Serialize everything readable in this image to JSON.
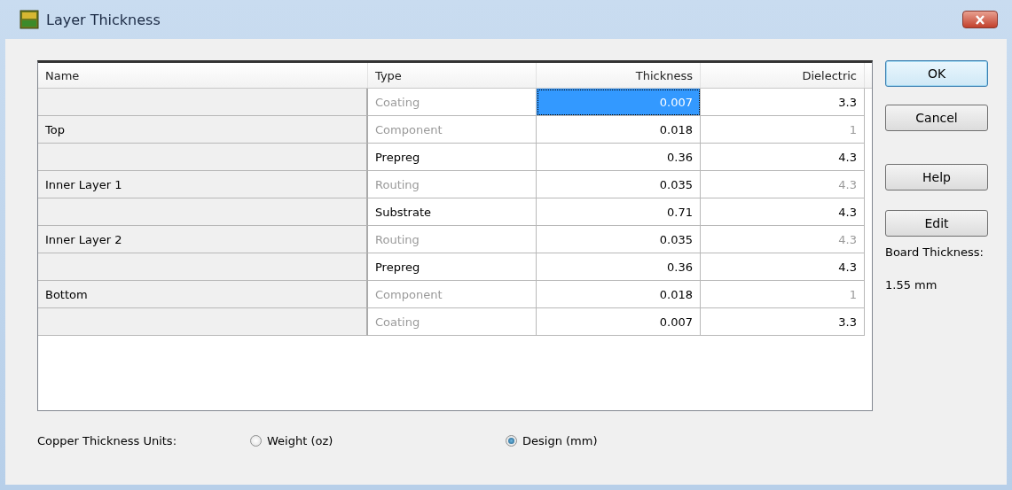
{
  "window": {
    "title": "Layer Thickness"
  },
  "table": {
    "columns": [
      "Name",
      "Type",
      "Thickness",
      "Dielectric"
    ],
    "rows": [
      {
        "name": "",
        "type": "Coating",
        "type_disabled": true,
        "thickness": "0.007",
        "selected": true,
        "dielectric": "3.3",
        "dielectric_disabled": false
      },
      {
        "name": "Top",
        "type": "Component",
        "type_disabled": true,
        "thickness": "0.018",
        "selected": false,
        "dielectric": "1",
        "dielectric_disabled": true
      },
      {
        "name": "",
        "type": "Prepreg",
        "type_disabled": false,
        "thickness": "0.36",
        "selected": false,
        "dielectric": "4.3",
        "dielectric_disabled": false
      },
      {
        "name": "Inner Layer 1",
        "type": "Routing",
        "type_disabled": true,
        "thickness": "0.035",
        "selected": false,
        "dielectric": "4.3",
        "dielectric_disabled": true
      },
      {
        "name": "",
        "type": "Substrate",
        "type_disabled": false,
        "thickness": "0.71",
        "selected": false,
        "dielectric": "4.3",
        "dielectric_disabled": false
      },
      {
        "name": "Inner Layer 2",
        "type": "Routing",
        "type_disabled": true,
        "thickness": "0.035",
        "selected": false,
        "dielectric": "4.3",
        "dielectric_disabled": true
      },
      {
        "name": "",
        "type": "Prepreg",
        "type_disabled": false,
        "thickness": "0.36",
        "selected": false,
        "dielectric": "4.3",
        "dielectric_disabled": false
      },
      {
        "name": "Bottom",
        "type": "Component",
        "type_disabled": true,
        "thickness": "0.018",
        "selected": false,
        "dielectric": "1",
        "dielectric_disabled": true
      },
      {
        "name": "",
        "type": "Coating",
        "type_disabled": true,
        "thickness": "0.007",
        "selected": false,
        "dielectric": "3.3",
        "dielectric_disabled": false
      }
    ]
  },
  "buttons": [
    {
      "label": "OK",
      "default": true
    },
    {
      "label": "Cancel",
      "default": false
    },
    {
      "label": "Help",
      "default": false
    },
    {
      "label": "Edit",
      "default": false
    }
  ],
  "board_thickness": {
    "label": "Board Thickness:",
    "value": "1.55 mm"
  },
  "units": {
    "label": "Copper Thickness Units:",
    "options": [
      {
        "label": "Weight (oz)",
        "selected": false
      },
      {
        "label": "Design (mm)",
        "selected": true
      }
    ]
  }
}
